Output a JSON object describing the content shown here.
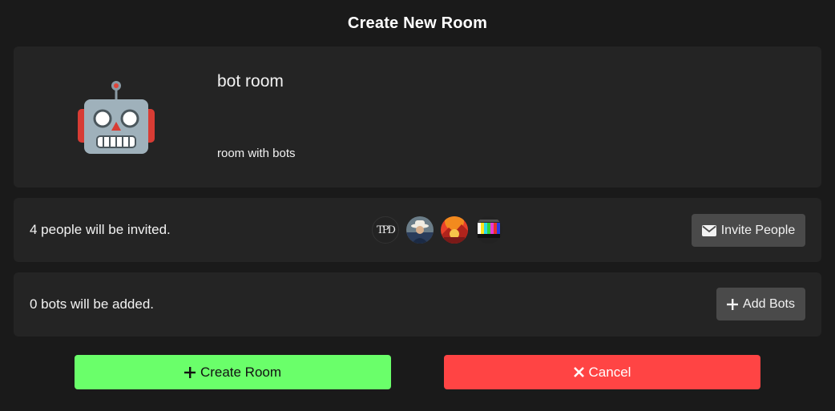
{
  "dialog": {
    "title": "Create New Room"
  },
  "room": {
    "icon": "robot-icon",
    "name": "bot room",
    "description": "room with bots"
  },
  "invite": {
    "summary": "4 people will be invited.",
    "avatars": [
      "TPD",
      "user-photo",
      "user-artwork",
      "test-pattern"
    ],
    "avatar_monogram": "TPD",
    "button_label": "Invite People",
    "button_icon": "envelope-icon"
  },
  "bots": {
    "summary": "0 bots will be added.",
    "button_label": "Add Bots",
    "button_icon": "plus-icon"
  },
  "actions": {
    "create_label": "Create Room",
    "create_icon": "plus-icon",
    "create_color": "#6aff6a",
    "cancel_label": "Cancel",
    "cancel_icon": "x-icon",
    "cancel_color": "#ff4444"
  }
}
